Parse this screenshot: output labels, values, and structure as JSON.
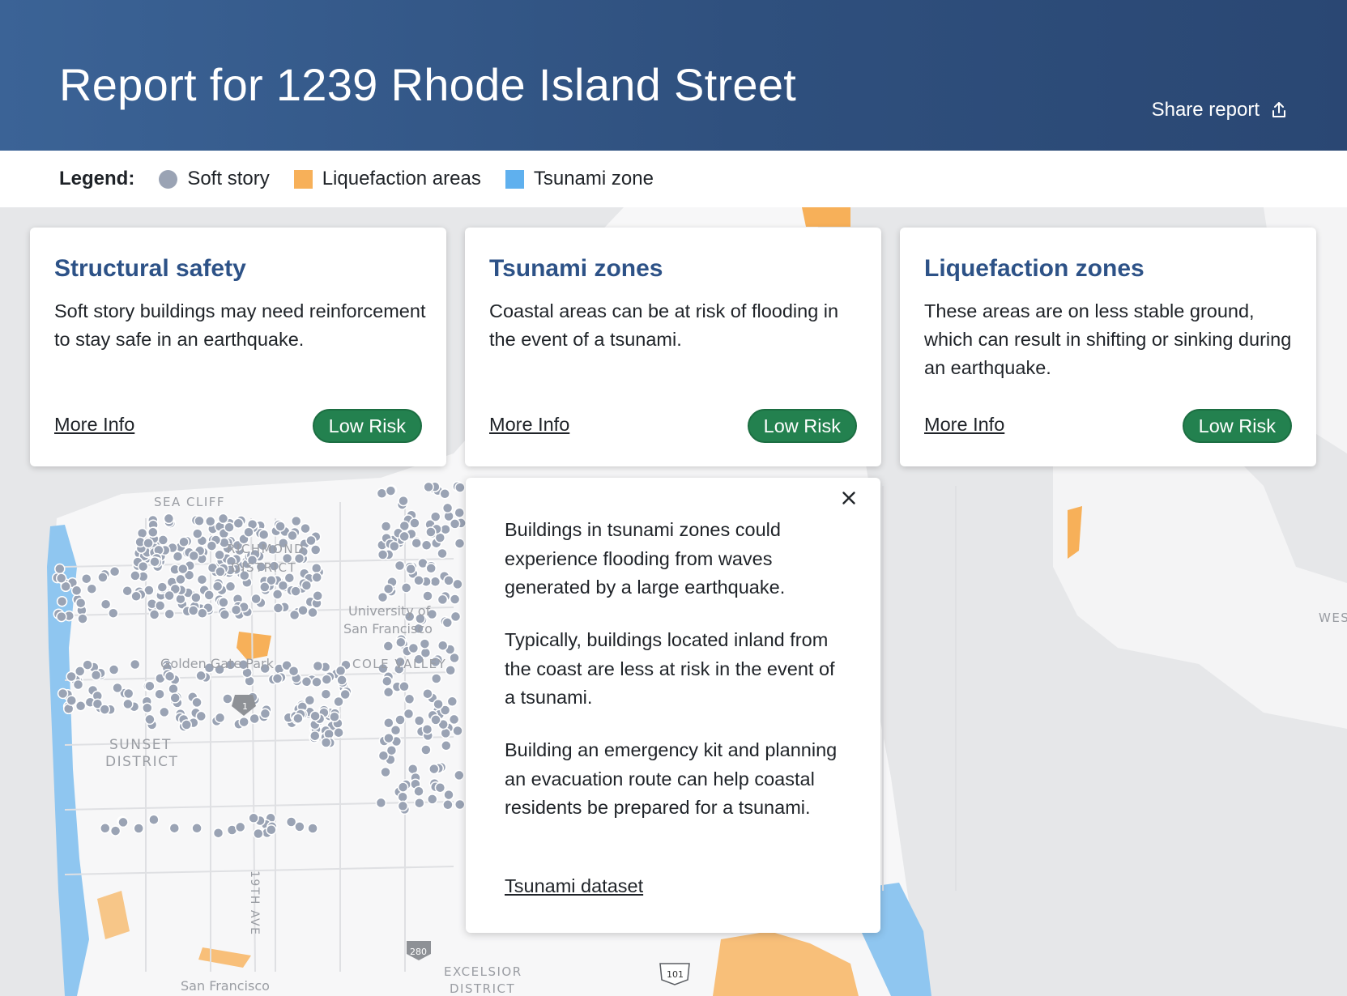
{
  "header": {
    "title": "Report for 1239 Rhode Island Street",
    "share_label": "Share report",
    "share_icon": "share-upload-icon"
  },
  "legend": {
    "title": "Legend:",
    "items": [
      {
        "label": "Soft story",
        "color": "#9aa3b4",
        "shape": "circle"
      },
      {
        "label": "Liquefaction areas",
        "color": "#f7b059",
        "shape": "square"
      },
      {
        "label": "Tsunami zone",
        "color": "#5fb0ee",
        "shape": "square"
      }
    ]
  },
  "cards": [
    {
      "title": "Structural safety",
      "body": "Soft story buildings may need reinforcement to stay safe in an earthquake.",
      "link": "More Info",
      "badge": "Low Risk"
    },
    {
      "title": "Tsunami zones",
      "body": "Coastal areas can be at risk of flooding in the event of a tsunami.",
      "link": "More Info",
      "badge": "Low Risk"
    },
    {
      "title": "Liquefaction zones",
      "body": "These areas are on less stable ground, which can result in shifting or sinking during an earthquake.",
      "link": "More Info",
      "badge": "Low Risk"
    }
  ],
  "popup": {
    "paragraphs": [
      "Buildings in tsunami zones could experience flooding from waves generated by a large earthquake.",
      "Typically, buildings located inland from the coast are less at risk in the event of a tsunami.",
      "Building an emergency kit and planning an evacuation route can help coastal residents be prepared for a tsunami."
    ],
    "link": "Tsunami dataset",
    "close_icon": "close-icon"
  },
  "map": {
    "labels": {
      "sea_cliff": "SEA CLIFF",
      "richmond_1": "RICHMOND",
      "richmond_2": "DISTRICT",
      "usf_1": "University of",
      "usf_2": "San Francisco",
      "golden_gate_park": "Golden Gate Park",
      "cole_valley": "COLE VALLEY",
      "sunset_1": "SUNSET",
      "sunset_2": "DISTRICT",
      "ave19": "19TH AVE",
      "san_francisco": "San Francisco",
      "excelsior_1": "EXCELSIOR",
      "excelsior_2": "DISTRICT",
      "west": "WES",
      "hwy1": "1",
      "hwy280": "280",
      "hwy101": "101"
    },
    "colors": {
      "land": "#f7f7f8",
      "water": "#e2e3e5",
      "soft_story": "#9aa3b4",
      "liquefaction": "#f7b059",
      "tsunami": "#8fc6f0"
    }
  }
}
